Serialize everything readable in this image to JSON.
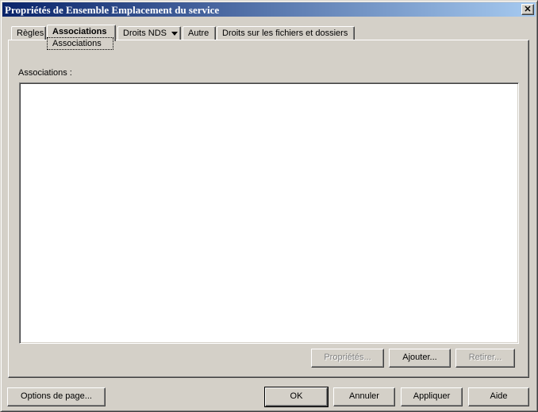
{
  "window": {
    "title": "Propriétés de Ensemble Emplacement du service",
    "close_glyph": "✕"
  },
  "tabs": [
    {
      "label": "Règles"
    },
    {
      "label": "Associations",
      "active": true
    },
    {
      "label": "Droits NDS"
    },
    {
      "label": "Autre"
    },
    {
      "label": "Droits sur les fichiers et dossiers"
    }
  ],
  "tooltip": {
    "text": "Associations"
  },
  "associations": {
    "label": "Associations :",
    "items": [],
    "buttons": {
      "properties": "Propriétés...",
      "add": "Ajouter...",
      "remove": "Retirer..."
    }
  },
  "footer": {
    "page_options": "Options de page...",
    "ok": "OK",
    "cancel": "Annuler",
    "apply": "Appliquer",
    "help": "Aide"
  },
  "icons": {
    "close": "close-icon",
    "dropdown": "chevron-down-icon"
  }
}
